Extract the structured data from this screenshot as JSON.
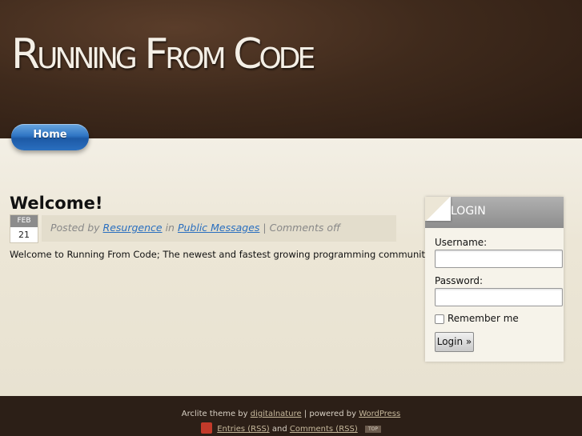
{
  "site": {
    "title": "Running From Code"
  },
  "nav": {
    "home_label": "Home"
  },
  "post": {
    "title": "Welcome!",
    "date_month": "FEB",
    "date_day": "21",
    "meta_prefix": "Posted by",
    "author": "Resurgence",
    "meta_in": "in",
    "category": "Public Messages",
    "meta_suffix": "| Comments off",
    "body": "Welcome to Running From Code; The newest and fastest growing programming community!"
  },
  "login": {
    "title": "LOGIN",
    "username_label": "Username:",
    "password_label": "Password:",
    "remember_label": "Remember me",
    "button_label": "Login »"
  },
  "footer": {
    "theme_text": "Arclite theme by",
    "theme_author": "digitalnature",
    "powered_text": "| powered by",
    "powered_link": "WordPress",
    "entries_rss": "Entries (RSS)",
    "and_text": "and",
    "comments_rss": "Comments (RSS)",
    "top_label": "TOP"
  },
  "colors": {
    "accent": "#2a6fbf",
    "header_brown": "#3f2a1c",
    "footer_brown": "#2c1f17"
  }
}
